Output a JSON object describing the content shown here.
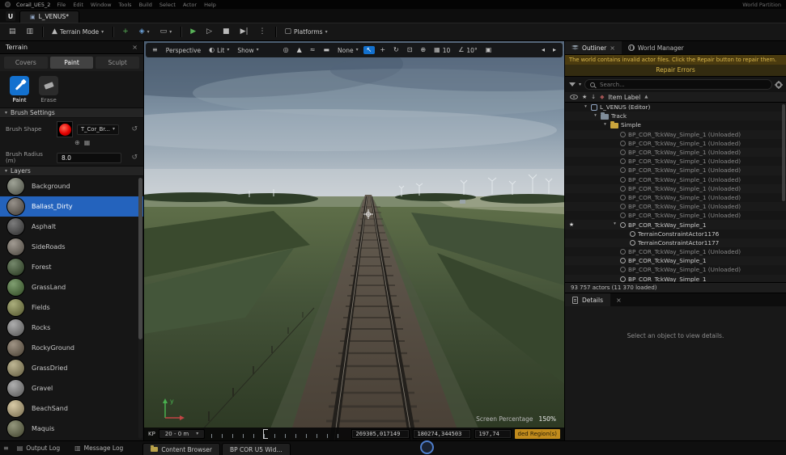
{
  "icons": {
    "hamburger": "≡",
    "caret_down": "▾",
    "caret_right": "▸",
    "close": "×",
    "play": "▶",
    "play_outline": "▷",
    "stop": "■",
    "step_forward": "▶|",
    "kebab": "⋮",
    "select_arrow": "↖",
    "move": "+",
    "rotate": "↻",
    "scale": "⊡",
    "world": "⊕",
    "grid": "▦",
    "angle": "∠",
    "camera": "▣",
    "half_sphere": "◐",
    "mountain": "▲",
    "star": "★",
    "sort_asc": "▲",
    "arrow_down": "↓",
    "diamond": "◆",
    "reset": "↺",
    "save": "▤",
    "browser": "▥",
    "blueprint": "◈",
    "clapper": "▭",
    "monitor": "▢",
    "arrow_left": "◂",
    "arrow_right": "▸",
    "add": "+",
    "logo": "U",
    "wand": "◎",
    "terrain_tool": "▲",
    "smooth_tool": "≈",
    "flatten_tool": "▬"
  },
  "title_bar": {
    "title": "Corail_UE5_2",
    "menus": [
      "File",
      "Edit",
      "Window",
      "Tools",
      "Build",
      "Select",
      "Actor",
      "Help"
    ],
    "right_text": "World Partition"
  },
  "level_tab": {
    "label": "L_VENUS*"
  },
  "toolbar": {
    "mode_label": "Terrain Mode",
    "platforms_label": "Platforms"
  },
  "terrain_panel": {
    "title": "Terrain",
    "tabs": [
      {
        "label": "Covers",
        "cls": ""
      },
      {
        "label": "Paint",
        "cls": "active"
      },
      {
        "label": "Sculpt",
        "cls": ""
      }
    ],
    "tools": [
      {
        "label": "Paint",
        "cls": "active",
        "glyph": "brush"
      },
      {
        "label": "Erase",
        "cls": "",
        "glyph": "eraser"
      }
    ],
    "brush_section": "Brush Settings",
    "brush_shape_label": "Brush Shape",
    "brush_texture": "T_Cor_Br...",
    "brush_radius_label": "Brush Radius (m)",
    "brush_radius_value": "8.0",
    "layers_section": "Layers",
    "layers": [
      {
        "name": "Background",
        "color": "#7a7f6e",
        "cls": ""
      },
      {
        "name": "Ballast_Dirty",
        "color": "#6e665c",
        "cls": "selected"
      },
      {
        "name": "Asphalt",
        "color": "#4a4a4a",
        "cls": ""
      },
      {
        "name": "SideRoads",
        "color": "#7d7468",
        "cls": ""
      },
      {
        "name": "Forest",
        "color": "#3f5a32",
        "cls": ""
      },
      {
        "name": "GrassLand",
        "color": "#4f7a3a",
        "cls": ""
      },
      {
        "name": "Fields",
        "color": "#8a8f4a",
        "cls": ""
      },
      {
        "name": "Rocks",
        "color": "#8d8d8d",
        "cls": ""
      },
      {
        "name": "RockyGround",
        "color": "#7a6a55",
        "cls": ""
      },
      {
        "name": "GrassDried",
        "color": "#a59a6a",
        "cls": ""
      },
      {
        "name": "Gravel",
        "color": "#909090",
        "cls": ""
      },
      {
        "name": "BeachSand",
        "color": "#c9b684",
        "cls": ""
      },
      {
        "name": "Maquis",
        "color": "#6b6f4a",
        "cls": ""
      }
    ]
  },
  "viewport": {
    "perspective": "Perspective",
    "lit": "Lit",
    "show": "Show",
    "none": "None",
    "grid_snap": "10",
    "angle_snap": "10°",
    "screen_percentage_label": "Screen Percentage",
    "screen_percentage_value": "150%",
    "kp_label": "KP",
    "kp_value": "20 - 0 m",
    "coord_x": "269305,017149",
    "coord_y": "180274,344503",
    "coord_z": "197,74",
    "region_text": "ded Region(s)",
    "axis_y": "y"
  },
  "outliner": {
    "tab": "Outliner",
    "world_manager_tab": "World Manager",
    "warning": "The world contains invalid actor files. Click the Repair button to repair them.",
    "repair_label": "Repair Errors",
    "search_placeholder": "Search...",
    "header_label": "Item Label",
    "status": "93 757 actors (11 370 loaded)",
    "tree": [
      {
        "label": "L_VENUS (Editor)",
        "level": 0,
        "icon": "level",
        "cls": "loaded",
        "exp": "▾"
      },
      {
        "label": "Track",
        "level": 1,
        "icon": "folder",
        "cls": "loaded",
        "exp": "▾"
      },
      {
        "label": "Simple",
        "level": 2,
        "icon": "folder-y",
        "cls": "loaded",
        "exp": "▾"
      },
      {
        "label": "BP_COR_TckWay_Simple_1 (Unloaded)",
        "level": 3,
        "icon": "actor-dim",
        "cls": "unloaded"
      },
      {
        "label": "BP_COR_TckWay_Simple_1 (Unloaded)",
        "level": 3,
        "icon": "actor-dim",
        "cls": "unloaded"
      },
      {
        "label": "BP_COR_TckWay_Simple_1 (Unloaded)",
        "level": 3,
        "icon": "actor-dim",
        "cls": "unloaded"
      },
      {
        "label": "BP_COR_TckWay_Simple_1 (Unloaded)",
        "level": 3,
        "icon": "actor-dim",
        "cls": "unloaded"
      },
      {
        "label": "BP_COR_TckWay_Simple_1 (Unloaded)",
        "level": 3,
        "icon": "actor-dim",
        "cls": "unloaded"
      },
      {
        "label": "BP_COR_TckWay_Simple_1 (Unloaded)",
        "level": 3,
        "icon": "actor-dim",
        "cls": "unloaded"
      },
      {
        "label": "BP_COR_TckWay_Simple_1 (Unloaded)",
        "level": 3,
        "icon": "actor-dim",
        "cls": "unloaded"
      },
      {
        "label": "BP_COR_TckWay_Simple_1 (Unloaded)",
        "level": 3,
        "icon": "actor-dim",
        "cls": "unloaded"
      },
      {
        "label": "BP_COR_TckWay_Simple_1 (Unloaded)",
        "level": 3,
        "icon": "actor-dim",
        "cls": "unloaded"
      },
      {
        "label": "BP_COR_TckWay_Simple_1 (Unloaded)",
        "level": 3,
        "icon": "actor-dim",
        "cls": "unloaded"
      },
      {
        "label": "BP_COR_TckWay_Simple_1",
        "level": 3,
        "icon": "actor",
        "cls": "loaded",
        "exp": "▾",
        "star": "★"
      },
      {
        "label": "TerrainConstraintActor1176",
        "level": 4,
        "icon": "actor",
        "cls": "loaded"
      },
      {
        "label": "TerrainConstraintActor1177",
        "level": 4,
        "icon": "actor",
        "cls": "loaded"
      },
      {
        "label": "BP_COR_TckWay_Simple_1 (Unloaded)",
        "level": 3,
        "icon": "actor-dim",
        "cls": "unloaded"
      },
      {
        "label": "BP_COR_TckWay_Simple_1",
        "level": 3,
        "icon": "actor",
        "cls": "loaded"
      },
      {
        "label": "BP_COR_TckWay_Simple_1 (Unloaded)",
        "level": 3,
        "icon": "actor-dim",
        "cls": "unloaded"
      },
      {
        "label": "BP_COR_TckWay_Simple_1",
        "level": 3,
        "icon": "actor",
        "cls": "loaded"
      }
    ]
  },
  "details": {
    "tab": "Details",
    "empty_text": "Select an object to view details."
  },
  "status_bar": {
    "items": [
      {
        "label": "Output Log"
      },
      {
        "label": "Message Log"
      }
    ],
    "tabs": [
      {
        "label": "Content Browser"
      },
      {
        "label": "BP COR U5 Wid..."
      }
    ]
  }
}
